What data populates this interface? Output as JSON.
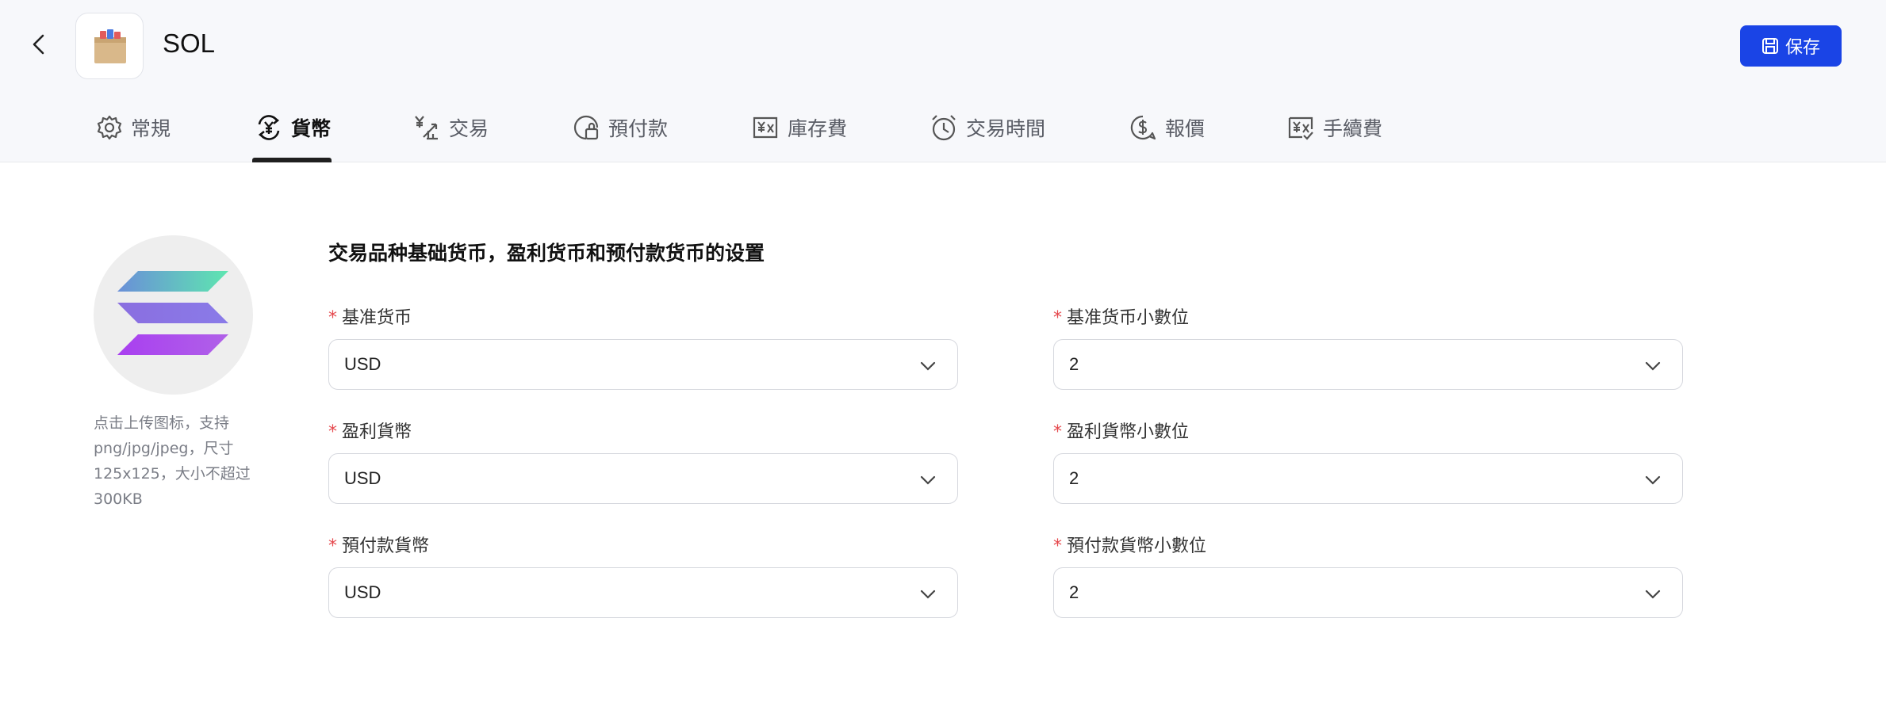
{
  "header": {
    "title": "SOL",
    "save_label": "保存"
  },
  "tabs": [
    {
      "label": "常規",
      "icon": "gear-icon"
    },
    {
      "label": "貨幣",
      "icon": "currency-exchange-icon"
    },
    {
      "label": "交易",
      "icon": "trade-icon"
    },
    {
      "label": "預付款",
      "icon": "prepayment-icon"
    },
    {
      "label": "庫存費",
      "icon": "inventory-fee-icon"
    },
    {
      "label": "交易時間",
      "icon": "alarm-clock-icon"
    },
    {
      "label": "報價",
      "icon": "quote-dollar-icon"
    },
    {
      "label": "手續費",
      "icon": "commission-icon"
    }
  ],
  "active_tab": "貨幣",
  "upload": {
    "hint": "点击上传图标，支持png/jpg/jpeg，尺寸125x125，大小不超过300KB"
  },
  "section": {
    "title": "交易品种基础货币，盈利货币和预付款货币的设置"
  },
  "fields": {
    "base_currency": {
      "label": "基准货币",
      "value": "USD"
    },
    "base_currency_decimals": {
      "label": "基准货币小數位",
      "value": "2"
    },
    "profit_currency": {
      "label": "盈利貨幣",
      "value": "USD"
    },
    "profit_currency_decimals": {
      "label": "盈利貨幣小數位",
      "value": "2"
    },
    "margin_currency": {
      "label": "預付款貨幣",
      "value": "USD"
    },
    "margin_currency_decimals": {
      "label": "預付款貨幣小數位",
      "value": "2"
    }
  },
  "colors": {
    "accent": "#1a44e6",
    "required": "#e5484d",
    "header_bg": "#f7f8fb"
  }
}
